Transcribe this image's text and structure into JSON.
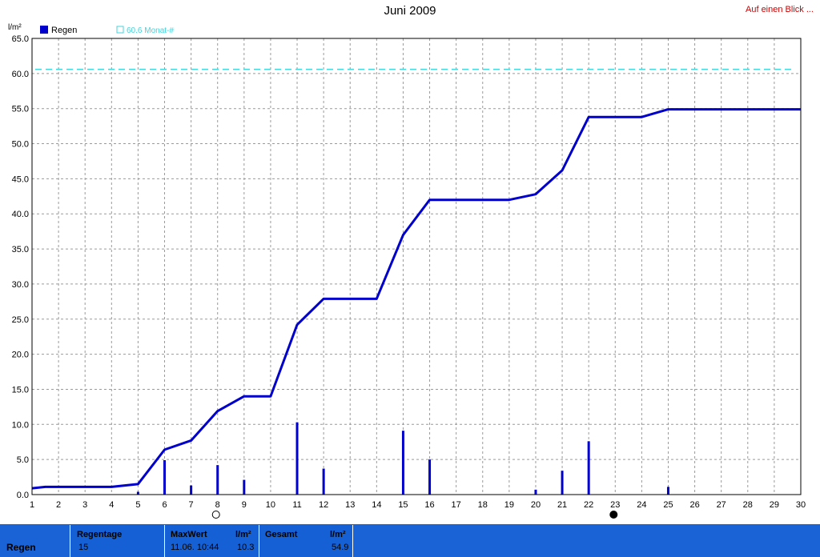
{
  "title": "Juni 2009",
  "link_text": "Auf einen Blick ...",
  "unit_label": "l/m²",
  "legend": {
    "series_label": "Regen",
    "reference_label": "60.6 Monat-#"
  },
  "colors": {
    "series": "#0000cc",
    "reference": "#44d4dc",
    "footer": "#1460d4",
    "link": "#d00000"
  },
  "chart_data": {
    "type": "line",
    "title": "Juni 2009",
    "ylabel": "l/m²",
    "xlabel": "",
    "xlim": [
      1,
      30
    ],
    "ylim": [
      0,
      65
    ],
    "grid": true,
    "legend_position": "top-left",
    "x_ticks": [
      "1",
      "2",
      "3",
      "4",
      "5",
      "6",
      "7",
      "8",
      "9",
      "10",
      "11",
      "12",
      "13",
      "14",
      "15",
      "16",
      "17",
      "18",
      "19",
      "20",
      "21",
      "22",
      "23",
      "24",
      "25",
      "26",
      "27",
      "28",
      "29",
      "30"
    ],
    "y_ticks": [
      "0.0",
      "5.0",
      "10.0",
      "15.0",
      "20.0",
      "25.0",
      "30.0",
      "35.0",
      "40.0",
      "45.0",
      "50.0",
      "55.0",
      "60.0",
      "65.0"
    ],
    "reference_line": {
      "name": "60.6 Monat-#",
      "value": 60.6
    },
    "cumulative_series": {
      "name": "Regen",
      "x": [
        1,
        1.5,
        2,
        3,
        4,
        5,
        6,
        7,
        8,
        9,
        10,
        11,
        12,
        13,
        14,
        15,
        16,
        17,
        18,
        19,
        20,
        21,
        22,
        23,
        24,
        25,
        26,
        27,
        28,
        29,
        30
      ],
      "y": [
        0.9,
        1.1,
        1.1,
        1.1,
        1.1,
        1.5,
        6.4,
        7.7,
        11.9,
        14.0,
        14.0,
        24.2,
        27.9,
        27.9,
        27.9,
        37.0,
        42.0,
        42.0,
        42.0,
        42.0,
        42.8,
        46.2,
        53.8,
        53.8,
        53.8,
        54.9,
        54.9,
        54.9,
        54.9,
        54.9,
        54.9
      ]
    },
    "daily_bars": {
      "name": "Regen",
      "x": [
        5,
        6,
        7,
        8,
        9,
        11,
        12,
        15,
        16,
        20,
        21,
        22,
        25
      ],
      "y": [
        0.4,
        4.9,
        1.3,
        4.2,
        2.1,
        10.3,
        3.7,
        9.1,
        5.0,
        0.7,
        3.4,
        7.6,
        1.1
      ]
    },
    "moon_markers": [
      {
        "day": 8,
        "phase": "first-quarter"
      },
      {
        "day": 23,
        "phase": "new-moon"
      }
    ]
  },
  "footer": {
    "label": "Regen",
    "regentage": {
      "header": "Regentage",
      "value": "15"
    },
    "maxwert": {
      "header": "MaxWert",
      "unit": "l/m²",
      "datetime": "11.06. 10:44",
      "value": "10.3"
    },
    "gesamt": {
      "header": "Gesamt",
      "unit": "l/m²",
      "value": "54.9"
    }
  }
}
